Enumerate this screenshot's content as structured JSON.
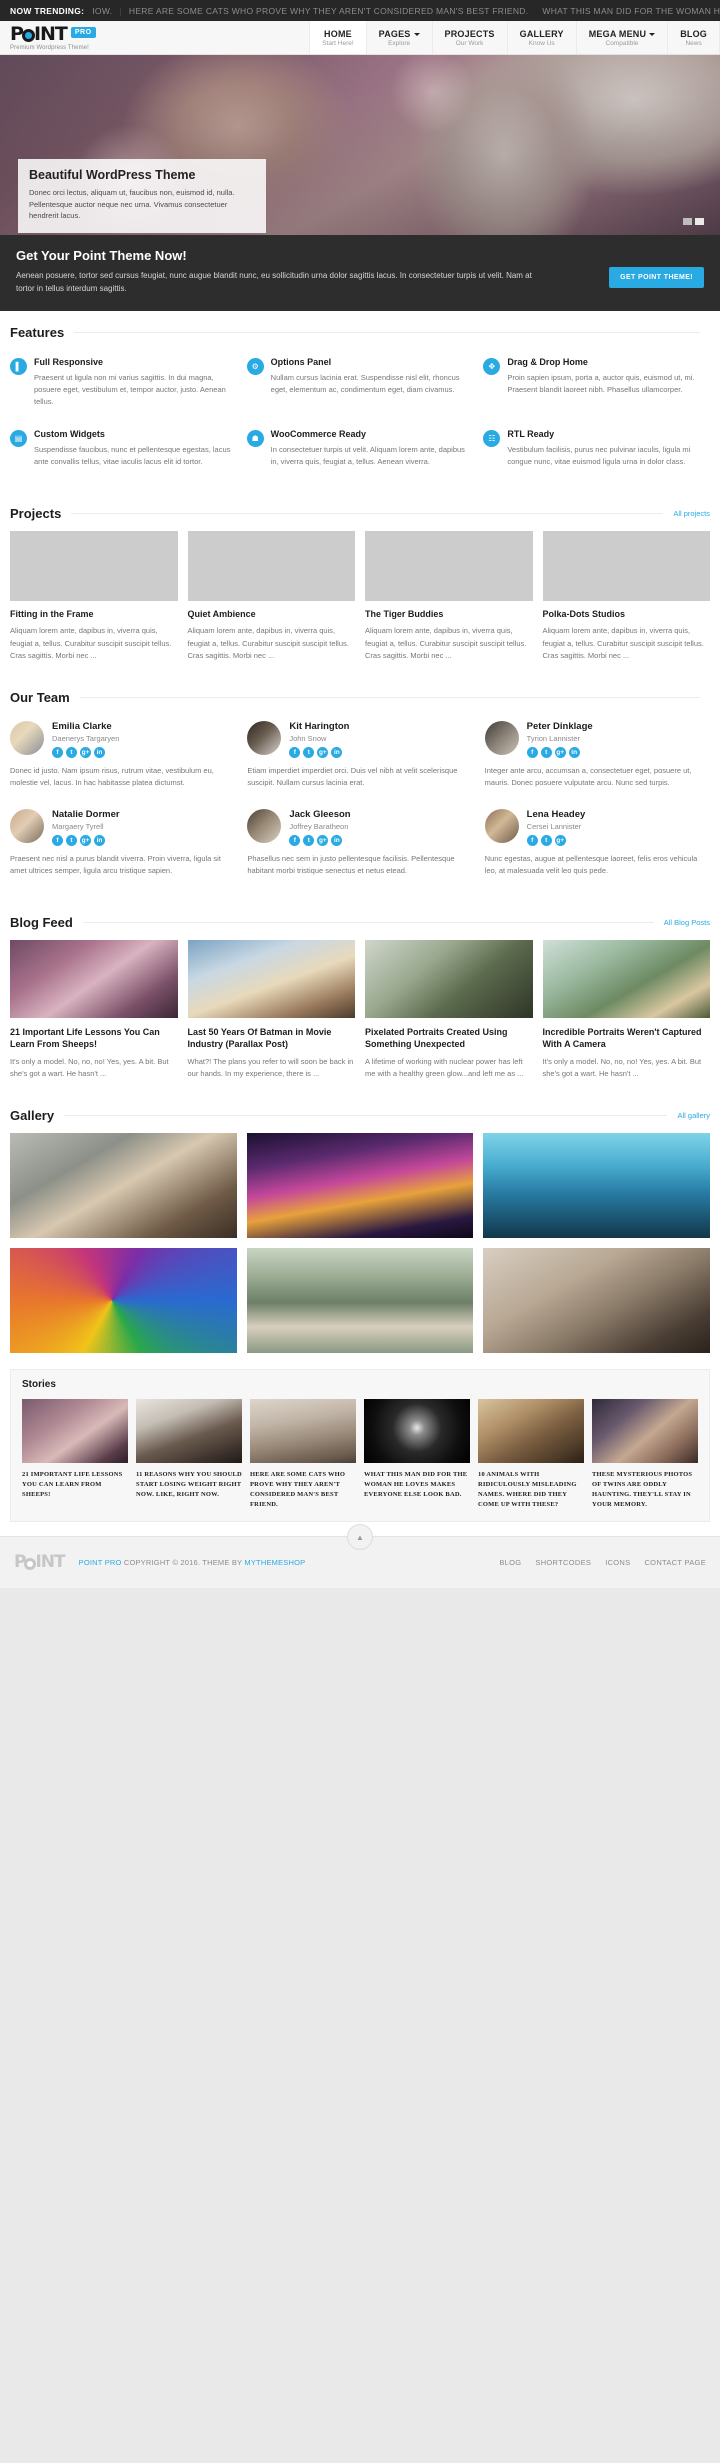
{
  "topbar": {
    "label": "NOW TRENDING:",
    "ticker": "IOW.",
    "items": [
      "HERE ARE SOME CATS WHO PROVE WHY THEY AREN'T CONSIDERED MAN'S BEST FRIEND.",
      "WHAT THIS MAN DID FOR THE WOMAN HE LOVE"
    ]
  },
  "header": {
    "brand": {
      "text_left": "P",
      "text_right": "INT",
      "badge": "PRO"
    },
    "tagline": "Premium Wordpress Theme!",
    "nav": [
      {
        "label": "HOME",
        "sub": "Start Here!",
        "caret": false,
        "active": true
      },
      {
        "label": "PAGES",
        "sub": "Explore",
        "caret": true,
        "active": false
      },
      {
        "label": "PROJECTS",
        "sub": "Our Work",
        "caret": false,
        "active": false
      },
      {
        "label": "GALLERY",
        "sub": "Know Us",
        "caret": false,
        "active": false
      },
      {
        "label": "MEGA MENU",
        "sub": "Compatible",
        "caret": true,
        "active": false
      },
      {
        "label": "BLOG",
        "sub": "News",
        "caret": false,
        "active": false
      }
    ]
  },
  "hero": {
    "title": "Beautiful WordPress Theme",
    "text": "Donec orci lectus, aliquam ut, faucibus non, euismod id, nulla. Pellentesque auctor neque nec urna. Vivamus consectetuer hendrerit lacus.",
    "slides": 2,
    "active_slide": 2
  },
  "cta": {
    "title": "Get Your Point Theme Now!",
    "text": "Aenean posuere, tortor sed cursus feugiat, nunc augue blandit nunc, eu sollicitudin urna dolor sagittis lacus. In consectetuer turpis ut velit. Nam at tortor in tellus interdum sagittis.",
    "button": "GET POINT THEME!",
    "accent": "#29aae3"
  },
  "features": {
    "title": "Features",
    "items": [
      {
        "icon": "mobile-icon",
        "glyph": "▌",
        "title": "Full Responsive",
        "text": "Praesent ut ligula non mi varius sagittis. In dui magna, posuere eget, vestibulum et, tempor auctor, justo. Aenean tellus."
      },
      {
        "icon": "gear-icon",
        "glyph": "⚙",
        "title": "Options Panel",
        "text": "Nullam cursus lacinia erat. Suspendisse nisl elit, rhoncus eget, elementum ac, condimentum eget, diam civamus."
      },
      {
        "icon": "move-icon",
        "glyph": "✥",
        "title": "Drag & Drop Home",
        "text": "Proin sapien ipsum, porta a, auctor quis, euismod ut, mi. Praesent blandit laoreet nibh. Phasellus ullamcorper."
      },
      {
        "icon": "widgets-icon",
        "glyph": "▤",
        "title": "Custom Widgets",
        "text": "Suspendisse faucibus, nunc et pellentesque egestas, lacus ante convallis tellus, vitae iaculis lacus elit id tortor."
      },
      {
        "icon": "cart-icon",
        "glyph": "☗",
        "title": "WooCommerce Ready",
        "text": "In consectetuer turpis ut velit. Aliquam lorem ante, dapibus in, viverra quis, feugiat a, tellus. Aenean viverra."
      },
      {
        "icon": "rtl-icon",
        "glyph": "☷",
        "title": "RTL Ready",
        "text": "Vestibulum facilisis, purus nec pulvinar iaculis, ligula mi congue nunc, vitae euismod ligula urna in dolor class."
      }
    ]
  },
  "projects": {
    "title": "Projects",
    "more": "All projects",
    "items": [
      {
        "thumb": "p1",
        "title": "Fitting in the Frame",
        "text": "Aliquam lorem ante, dapibus in, viverra quis, feugiat a, tellus. Curabitur suscipit suscipit tellus. Cras sagittis. Morbi nec ..."
      },
      {
        "thumb": "p2",
        "title": "Quiet Ambience",
        "text": "Aliquam lorem ante, dapibus in, viverra quis, feugiat a, tellus. Curabitur suscipit suscipit tellus. Cras sagittis. Morbi nec ..."
      },
      {
        "thumb": "p3",
        "title": "The Tiger Buddies",
        "text": "Aliquam lorem ante, dapibus in, viverra quis, feugiat a, tellus. Curabitur suscipit suscipit tellus. Cras sagittis. Morbi nec ..."
      },
      {
        "thumb": "p4",
        "title": "Polka-Dots Studios",
        "text": "Aliquam lorem ante, dapibus in, viverra quis, feugiat a, tellus. Curabitur suscipit suscipit tellus. Cras sagittis. Morbi nec ..."
      }
    ]
  },
  "team": {
    "title": "Our Team",
    "socials": [
      "f",
      "t",
      "g+",
      "in"
    ],
    "members": [
      {
        "av": "a1",
        "name": "Emilia Clarke",
        "role": "Daenerys Targaryen",
        "bio": "Donec id justo. Nam ipsum risus, rutrum vitae, vestibulum eu, molestie vel, lacus. In hac habitasse platea dictumst."
      },
      {
        "av": "a2",
        "name": "Kit Harington",
        "role": "John Snow",
        "bio": "Etiam imperdiet imperdiet orci. Duis vel nibh at velit scelerisque suscipit. Nullam cursus lacinia erat."
      },
      {
        "av": "a3",
        "name": "Peter Dinklage",
        "role": "Tyrion Lannister",
        "bio": "Integer ante arcu, accumsan a, consectetuer eget, posuere ut, mauris. Donec posuere vulputate arcu. Nunc sed turpis."
      },
      {
        "av": "a4",
        "name": "Natalie Dormer",
        "role": "Margaery Tyrell",
        "bio": "Praesent nec nisl a purus blandit viverra. Proin viverra, ligula sit amet ultrices semper, ligula arcu tristique sapien."
      },
      {
        "av": "a5",
        "name": "Jack Gleeson",
        "role": "Joffrey Baratheon",
        "bio": "Phasellus nec sem in justo pellentesque facilisis. Pellentesque habitant morbi tristique senectus et netus etead."
      },
      {
        "av": "a6",
        "name": "Lena Headey",
        "role": "Cersei Lannister",
        "bio": "Nunc egestas, augue at pellentesque laoreet, felis eros vehicula leo, at malesuada velit leo quis pede."
      }
    ]
  },
  "blog": {
    "title": "Blog Feed",
    "more": "All Blog Posts",
    "items": [
      {
        "thumb": "b1",
        "title": "21 Important Life Lessons You Can Learn From Sheeps!",
        "text": "It's only a model. No, no, no! Yes, yes. A bit. But she's got a wart. He hasn't ..."
      },
      {
        "thumb": "b2",
        "title": "Last 50 Years Of Batman in Movie Industry (Parallax Post)",
        "text": "What?! The plans you refer to will soon be back in our hands. In my experience, there is ..."
      },
      {
        "thumb": "b3",
        "title": "Pixelated Portraits Created Using Something Unexpected",
        "text": "A lifetime of working with nuclear power has left me with a healthy green glow...and left me as ..."
      },
      {
        "thumb": "b4",
        "title": "Incredible Portraits Weren't Captured With A Camera",
        "text": "It's only a model. No, no, no! Yes, yes. A bit. But she's got a wart. He hasn't ..."
      }
    ]
  },
  "gallery": {
    "title": "Gallery",
    "more": "All gallery",
    "cells": [
      "g1",
      "g2",
      "g3",
      "g4",
      "g5",
      "g6"
    ]
  },
  "stories": {
    "title": "Stories",
    "items": [
      {
        "thumb": "s1",
        "title": "21 IMPORTANT LIFE LESSONS YOU CAN LEARN FROM SHEEPS!"
      },
      {
        "thumb": "s2",
        "title": "11 REASONS WHY YOU SHOULD START LOSING WEIGHT RIGHT NOW. LIKE, RIGHT NOW."
      },
      {
        "thumb": "s3",
        "title": "HERE ARE SOME CATS WHO PROVE WHY THEY AREN'T CONSIDERED MAN'S BEST FRIEND."
      },
      {
        "thumb": "s4",
        "title": "WHAT THIS MAN DID FOR THE WOMAN HE LOVES MAKES EVERYONE ELSE LOOK BAD."
      },
      {
        "thumb": "s5",
        "title": "10 ANIMALS WITH RIDICULOUSLY MISLEADING NAMES. WHERE DID THEY COME UP WITH THESE?"
      },
      {
        "thumb": "s6",
        "title": "THESE MYSTERIOUS PHOTOS OF TWINS ARE ODDLY HAUNTING. THEY'LL STAY IN YOUR MEMORY."
      }
    ]
  },
  "footer": {
    "brand": {
      "text_left": "P",
      "text_right": "INT"
    },
    "copy_brand": "POINT PRO",
    "copy_mid": " COPYRIGHT © 2016. THEME BY ",
    "copy_link": "MYTHEMESHOP",
    "nav": [
      "BLOG",
      "SHORTCODES",
      "ICONS",
      "CONTACT PAGE"
    ],
    "scroll_top_icon": "▲"
  }
}
